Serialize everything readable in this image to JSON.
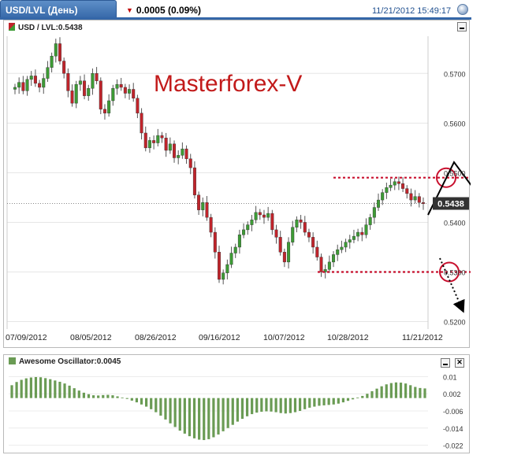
{
  "header": {
    "tab_title": "USD/LVL (День)",
    "change": "0.0005 (0.09%)",
    "timestamp": "11/21/2012 15:49:17"
  },
  "main_chart": {
    "title": "USD / LVL:0.5438",
    "watermark": "Masterforex-V",
    "price_label": "0.5438",
    "y_ticks": [
      "0.5700",
      "0.5600",
      "0.5500",
      "0.5400",
      "0.5300",
      "0.5200"
    ],
    "x_ticks": [
      "07/09/2012",
      "08/05/2012",
      "08/26/2012",
      "09/16/2012",
      "10/07/2012",
      "10/28/2012",
      "11/21/2012"
    ]
  },
  "oscillator": {
    "title": "Awesome Oscillator:0.0045",
    "y_ticks": [
      "0.01",
      "0.002",
      "-0.006",
      "-0.014",
      "-0.022"
    ]
  },
  "colors": {
    "up": "#3d9b35",
    "down": "#c0242b",
    "level": "#c8102e",
    "ao": "#6a9b54",
    "accent": "#3567a8"
  },
  "chart_data": [
    {
      "type": "candlestick",
      "title": "USD / LVL:0.5438",
      "x_labels": [
        "07/09/2012",
        "08/05/2012",
        "08/26/2012",
        "09/16/2012",
        "10/07/2012",
        "10/28/2012",
        "11/21/2012"
      ],
      "y_ticks": [
        0.57,
        0.56,
        0.55,
        0.54,
        0.53,
        0.52
      ],
      "ylim": [
        0.5185,
        0.5775
      ],
      "last": 0.5438,
      "levels": [
        0.549,
        0.53
      ],
      "closes": [
        0.5672,
        0.5682,
        0.5665,
        0.5688,
        0.5695,
        0.568,
        0.5672,
        0.569,
        0.5712,
        0.5735,
        0.576,
        0.5725,
        0.57,
        0.5665,
        0.564,
        0.5678,
        0.5685,
        0.5655,
        0.567,
        0.57,
        0.5685,
        0.5628,
        0.562,
        0.5645,
        0.567,
        0.5678,
        0.5672,
        0.566,
        0.5668,
        0.565,
        0.562,
        0.558,
        0.555,
        0.5565,
        0.556,
        0.5575,
        0.557,
        0.5545,
        0.5558,
        0.553,
        0.5535,
        0.5548,
        0.5528,
        0.551,
        0.5455,
        0.5425,
        0.544,
        0.541,
        0.538,
        0.534,
        0.5285,
        0.5298,
        0.5315,
        0.5338,
        0.535,
        0.5375,
        0.5385,
        0.5395,
        0.5405,
        0.542,
        0.5415,
        0.541,
        0.5418,
        0.5385,
        0.537,
        0.534,
        0.532,
        0.536,
        0.539,
        0.5405,
        0.54,
        0.538,
        0.537,
        0.535,
        0.533,
        0.53,
        0.5305,
        0.532,
        0.5335,
        0.5345,
        0.535,
        0.536,
        0.5365,
        0.5372,
        0.538,
        0.5375,
        0.5395,
        0.541,
        0.543,
        0.5445,
        0.546,
        0.547,
        0.5475,
        0.5482,
        0.5478,
        0.5468,
        0.5458,
        0.5445,
        0.5452,
        0.544,
        0.5438
      ]
    },
    {
      "type": "bar",
      "title": "Awesome Oscillator:0.0045",
      "y_ticks": [
        0.01,
        0.002,
        -0.006,
        -0.014,
        -0.022
      ],
      "ylim": [
        -0.024,
        0.012
      ],
      "values": [
        0.006,
        0.0075,
        0.0085,
        0.0092,
        0.0096,
        0.0098,
        0.0097,
        0.0093,
        0.0088,
        0.0082,
        0.0076,
        0.0068,
        0.0058,
        0.0046,
        0.0035,
        0.0025,
        0.0018,
        0.0013,
        0.0012,
        0.0014,
        0.0015,
        0.0013,
        0.0008,
        0.0002,
        -0.0004,
        -0.0012,
        -0.002,
        -0.003,
        -0.004,
        -0.0052,
        -0.0066,
        -0.0082,
        -0.01,
        -0.0118,
        -0.0135,
        -0.0152,
        -0.0166,
        -0.0178,
        -0.0188,
        -0.0194,
        -0.0196,
        -0.0192,
        -0.0183,
        -0.017,
        -0.0155,
        -0.014,
        -0.0125,
        -0.011,
        -0.0097,
        -0.0085,
        -0.0075,
        -0.0068,
        -0.0064,
        -0.0062,
        -0.0063,
        -0.0066,
        -0.007,
        -0.0072,
        -0.007,
        -0.0066,
        -0.006,
        -0.0052,
        -0.0045,
        -0.004,
        -0.0036,
        -0.0034,
        -0.0032,
        -0.003,
        -0.0026,
        -0.002,
        -0.0013,
        -0.0006,
        0.0002,
        0.001,
        0.002,
        0.0032,
        0.0044,
        0.0055,
        0.0064,
        0.007,
        0.0073,
        0.0072,
        0.0068,
        0.006,
        0.0052,
        0.0047,
        0.0045
      ]
    }
  ]
}
